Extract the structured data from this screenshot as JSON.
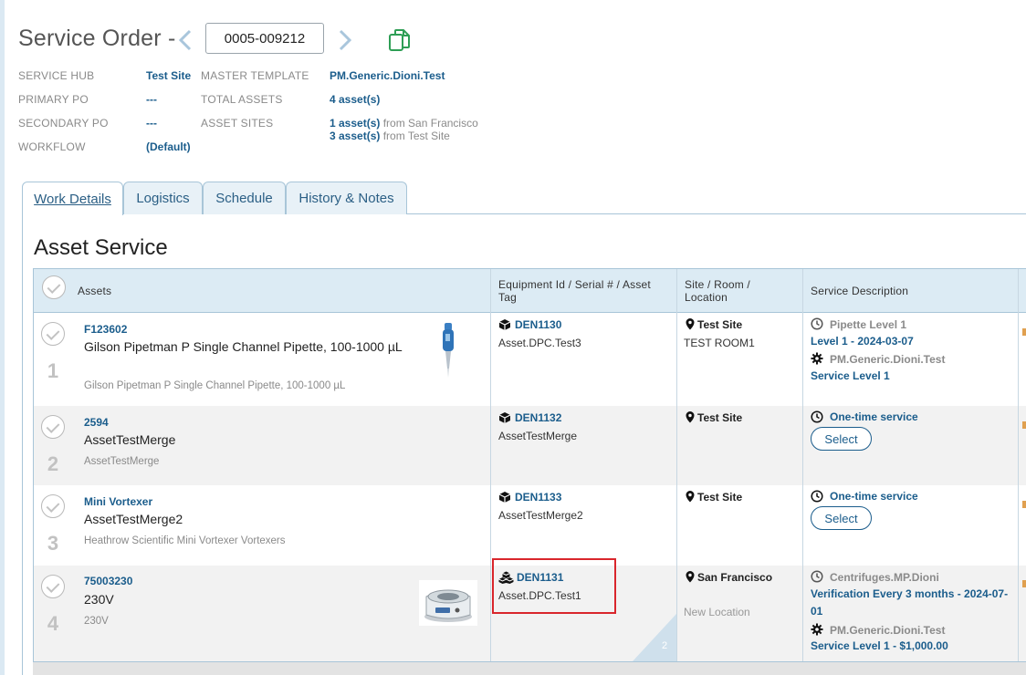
{
  "header": {
    "title": "Service Order -",
    "order_number": "0005-009212"
  },
  "meta": {
    "service_hub_label": "SERVICE HUB",
    "service_hub_value": "Test Site",
    "primary_po_label": "PRIMARY PO",
    "primary_po_value": "---",
    "secondary_po_label": "SECONDARY PO",
    "secondary_po_value": "---",
    "workflow_label": "WORKFLOW",
    "workflow_value": "(Default)",
    "master_template_label": "MASTER TEMPLATE",
    "master_template_value": "PM.Generic.Dioni.Test",
    "total_assets_label": "TOTAL ASSETS",
    "total_assets_value": "4 asset(s)",
    "asset_sites_label": "ASSET SITES",
    "asset_sites": [
      {
        "count": "1 asset(s)",
        "from": "from San Francisco"
      },
      {
        "count": "3 asset(s)",
        "from": "from Test Site"
      }
    ]
  },
  "tabs": [
    {
      "label": "Work Details",
      "active": true
    },
    {
      "label": "Logistics",
      "active": false
    },
    {
      "label": "Schedule",
      "active": false
    },
    {
      "label": "History & Notes",
      "active": false
    }
  ],
  "section": {
    "title": "Asset Service"
  },
  "table": {
    "columns": {
      "assets": "Assets",
      "equipment": "Equipment Id / Serial # / Asset Tag",
      "site": "Site / Room / Location",
      "service": "Service Description"
    },
    "rows": [
      {
        "num": "1",
        "asset_id": "F123602",
        "name": "Gilson Pipetman P Single Channel Pipette, 100-1000 µL",
        "desc": "Gilson Pipetman P Single Channel Pipette, 100-1000 µL",
        "equip_id": "DEN1130",
        "equip_tag": "Asset.DPC.Test3",
        "site": "Test Site",
        "room": "TEST ROOM1",
        "service_template": "Pipette Level 1",
        "service_level_date": "Level 1 - 2024-03-07",
        "service_pm": "PM.Generic.Dioni.Test",
        "service_level": "Service Level 1"
      },
      {
        "num": "2",
        "asset_id": "2594",
        "name": "AssetTestMerge",
        "desc": "AssetTestMerge",
        "equip_id": "DEN1132",
        "equip_tag": "AssetTestMerge",
        "site": "Test Site",
        "service_one_time": "One-time service",
        "select_label": "Select"
      },
      {
        "num": "3",
        "asset_id": "Mini Vortexer",
        "name": "AssetTestMerge2",
        "desc": "Heathrow Scientific Mini Vortexer Vortexers",
        "equip_id": "DEN1133",
        "equip_tag": "AssetTestMerge2",
        "site": "Test Site",
        "service_one_time": "One-time service",
        "select_label": "Select"
      },
      {
        "num": "4",
        "asset_id": "75003230",
        "name": "230V",
        "desc": "230V",
        "equip_id": "DEN1131",
        "equip_tag": "Asset.DPC.Test1",
        "site": "San Francisco",
        "location": "New Location",
        "service_template": "Centrifuges.MP.Dioni",
        "service_verification_1": "Verification Every 3 months - 2024-07-",
        "service_verification_2": "01",
        "service_pm": "PM.Generic.Dioni.Test",
        "service_level": "Service Level 1 - $1,000.00",
        "corner_badge": "2"
      }
    ]
  },
  "colors": {
    "accent_blue": "#1b5d8c",
    "header_bg": "#dcebf4",
    "highlight_red": "#d9262c",
    "copy_icon_green": "#2e9e55"
  },
  "icons": [
    "chevron-left-icon",
    "chevron-right-icon",
    "copy-icon",
    "check-circle-icon",
    "box-icon",
    "boxes-icon",
    "map-pin-icon",
    "clock-icon",
    "gear-icon",
    "pipette-image",
    "centrifuge-image"
  ]
}
